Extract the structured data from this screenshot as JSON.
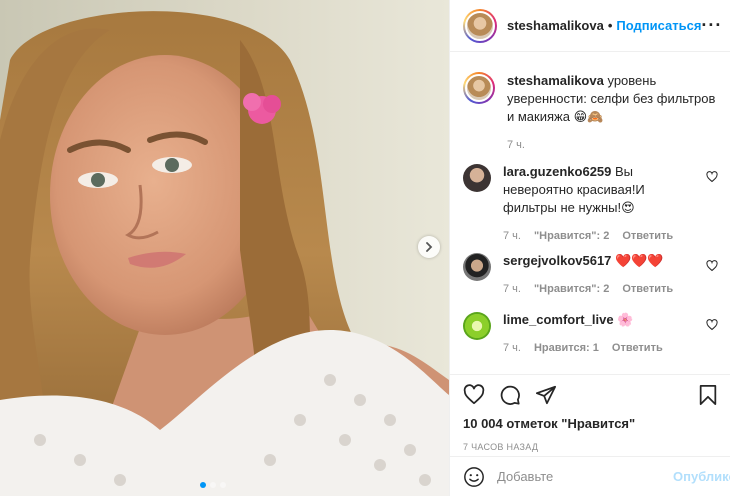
{
  "post": {
    "author": "steshamalikova",
    "separator": "•",
    "follow_label": "Подписаться",
    "more_label": "···",
    "caption_text": "уровень уверенности: селфи без фильтров и макияжа 😁🙈",
    "caption_time": "7 ч."
  },
  "comments": [
    {
      "username": "lara.guzenko6259",
      "text": "Вы невероятно красивая!И фильтры не нужны!😍",
      "time": "7 ч.",
      "likes": "\"Нравится\": 2",
      "reply": "Ответить"
    },
    {
      "username": "sergejvolkov5617",
      "text": "❤️❤️❤️",
      "time": "7 ч.",
      "likes": "\"Нравится\": 2",
      "reply": "Ответить"
    },
    {
      "username": "lime_comfort_live",
      "text": "🌸",
      "time": "7 ч.",
      "likes": "Нравится: 1",
      "reply": "Ответить"
    }
  ],
  "stats": {
    "likes_text": "10 004 отметок \"Нравится\"",
    "posted_ago": "7 ЧАСОВ НАЗАД"
  },
  "add_comment": {
    "placeholder": "Добавьте",
    "publish_label": "Опубликовать"
  },
  "icons": [
    "next-arrow-icon",
    "heart-icon",
    "comment-icon",
    "share-icon",
    "bookmark-icon",
    "emoji-icon",
    "more-icon"
  ],
  "carousel": {
    "total": 3,
    "active": 1
  },
  "colors": {
    "accent": "#0095f6",
    "publish_disabled": "#b2dffc",
    "muted": "#8e8e8e",
    "border": "#efefef"
  }
}
